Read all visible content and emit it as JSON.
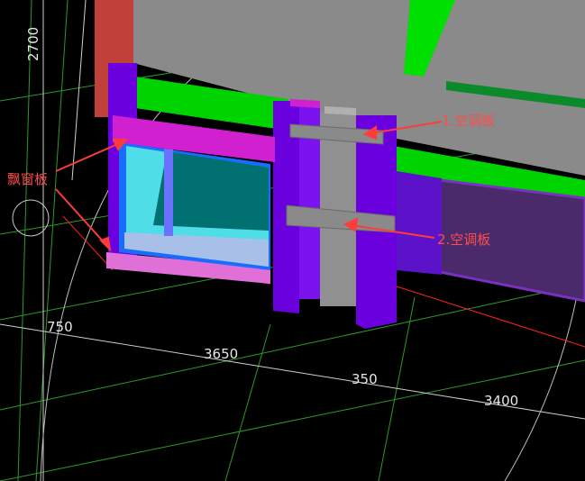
{
  "dimensions": {
    "d2700": "2700",
    "d750": "750",
    "d3650": "3650",
    "d350": "350",
    "d3400": "3400"
  },
  "annotations": {
    "bay_window_slab": "飘窗板",
    "ac_slab_1": "1.空调板",
    "ac_slab_2": "2.空调板"
  },
  "colors": {
    "background": "#000000",
    "grid_line": "#2a9a2a",
    "axis_circle": "#c8c8c8",
    "slab_gray": "#8a8a8a",
    "beam_green": "#00d400",
    "column_purple": "#6a00dd",
    "magenta_trim": "#d020d0",
    "window_blue": "#1a6cff",
    "glass_teal": "#007070",
    "annotation_red": "#ff4d4d"
  }
}
